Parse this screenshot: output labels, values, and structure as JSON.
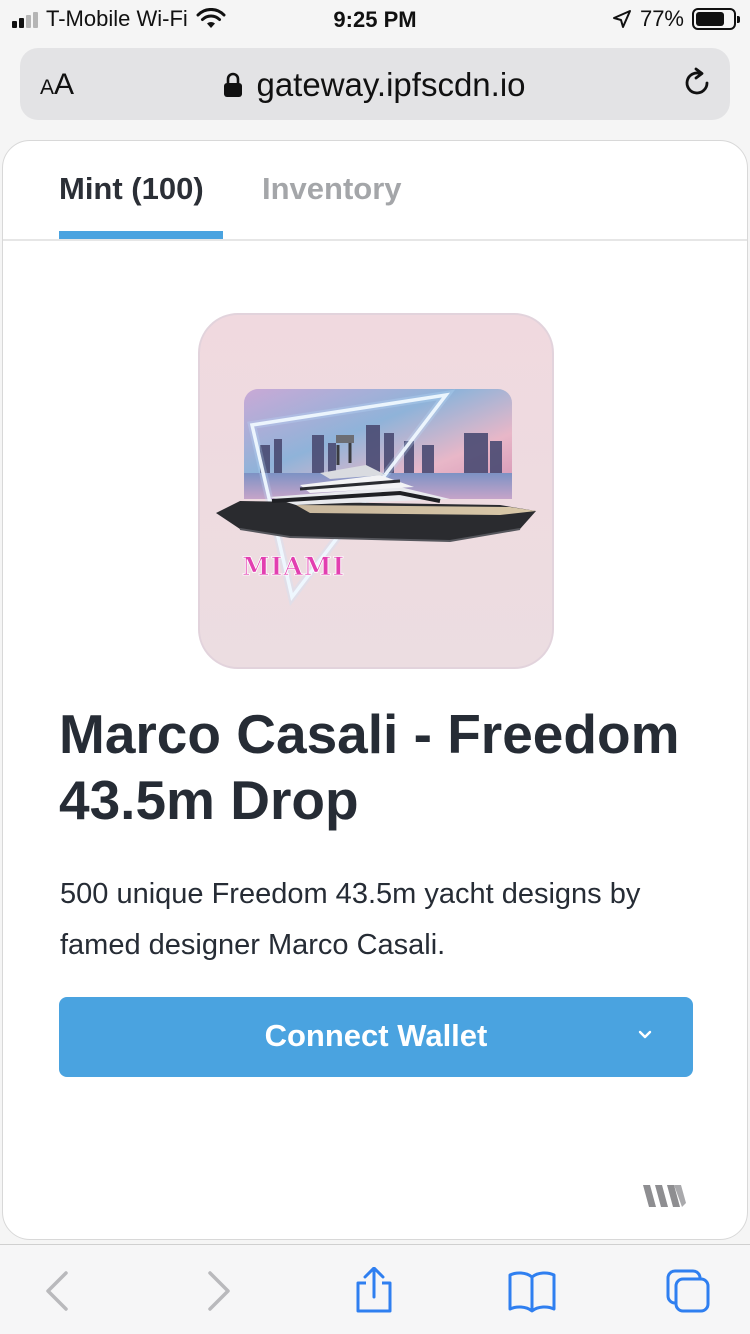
{
  "status_bar": {
    "carrier": "T-Mobile Wi-Fi",
    "time": "9:25 PM",
    "battery_percent": "77%",
    "battery_level": 0.77
  },
  "browser": {
    "text_size_label": "AA",
    "url": "gateway.ipfscdn.io"
  },
  "tabs": [
    {
      "label": "Mint (100)",
      "active": true
    },
    {
      "label": "Inventory",
      "active": false
    }
  ],
  "nft": {
    "image_text": "MIAMI",
    "title": "Marco Casali - Freedom 43.5m Drop",
    "description": "500 unique Freedom 43.5m yacht designs by famed designer Marco Casali."
  },
  "actions": {
    "connect_wallet_label": "Connect Wallet"
  },
  "colors": {
    "accent": "#4aa3e0",
    "title": "#262c35",
    "inactive_tab": "#a4a6a9",
    "toolbar_icon": "#2f7ff0"
  },
  "toolbar": {
    "icons": [
      "back-icon",
      "forward-icon",
      "share-icon",
      "bookmarks-icon",
      "tabs-icon"
    ]
  }
}
